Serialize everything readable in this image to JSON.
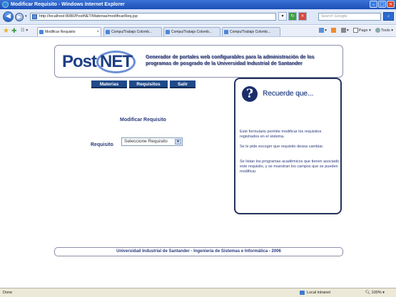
{
  "window": {
    "title": "Modificar Requisito - Windows Internet Explorer"
  },
  "address_bar": {
    "url": "http://localhost:8080/PostNET/Materias/modificarReq.jsp",
    "search_placeholder": "Search Google"
  },
  "tabs": [
    {
      "label": "Modificar Requisito"
    },
    {
      "label": "Compu/Trabajo Colomb..."
    },
    {
      "label": "Compu/Trabajo Colomb..."
    },
    {
      "label": "Compu/Trabajo Colomb..."
    }
  ],
  "command_bar": {
    "page_label": "Page",
    "tools_label": "Tools"
  },
  "banner": {
    "logo_text": "Post",
    "logo_ring_text": "NET",
    "tagline": "Generador de portales web configurables para la administración de los programas de posgrado de la Universidad Industrial de Santander"
  },
  "menu": [
    {
      "label": "Materias"
    },
    {
      "label": "Requisitos"
    },
    {
      "label": "Salir"
    }
  ],
  "form": {
    "title": "Modificar Requisito",
    "label": "Requisito",
    "select_value": "Seleccione Requisito"
  },
  "help": {
    "title": "Recuerde que...",
    "p1": "Este formulario permite modificar los requisitos registrados en el sistema.",
    "p2": "Se le pide escoger que requisito desea cambiar.",
    "p3": "Se listan los programas académicos que tienen asociado este requisito, y se muestran los campos que se pueden modificar."
  },
  "footer": {
    "text": "Universidad Industrial de Santander - Ingeniería de Sistemas e Informática - 2006"
  },
  "status_bar": {
    "left": "Done",
    "zone": "Local intranet",
    "zoom": "100%"
  },
  "colors": {
    "titlebar": "#1d4fb8",
    "menu_button": "#1f4a8a",
    "text_blue": "#2a3a7a",
    "help_border": "#26335e"
  }
}
